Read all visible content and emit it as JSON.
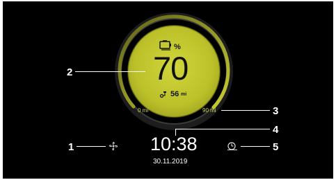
{
  "gauge": {
    "battery_percent_label": "%",
    "charge_value": "70",
    "range_value": "56",
    "range_unit": "mi",
    "min_label": "0 mi",
    "max_label": "90 mi"
  },
  "clock": {
    "time": "10:38",
    "date": "30.11.2019"
  },
  "callouts": {
    "c1": "1",
    "c2": "2",
    "c3": "3",
    "c4": "4",
    "c5": "5"
  },
  "icons": {
    "battery": "battery-icon",
    "range": "range-plug-icon",
    "fan": "fan-icon",
    "timer": "timer-clock-icon"
  },
  "colors": {
    "background": "#000000",
    "gauge_fill": "#bcc12a",
    "gauge_ring": "#2d2d2d",
    "arc_yellow": "#c2c72f",
    "text_white": "#ffffff",
    "text_dark": "#111111"
  }
}
